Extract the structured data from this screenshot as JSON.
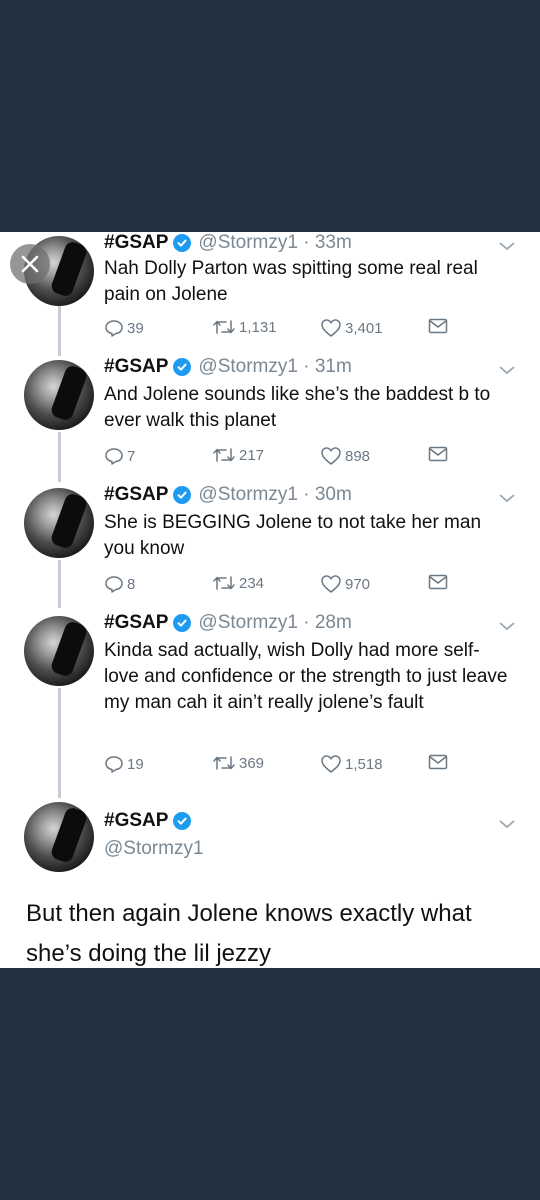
{
  "colors": {
    "background": "#22303f",
    "card": "#ffffff",
    "verified": "#1d9bf0",
    "muted": "#7a8894"
  },
  "viewer": {
    "close_icon": "close-icon"
  },
  "tweets": [
    {
      "name": "#GSAP",
      "handle": "@Stormzy1 · 33m",
      "text": "Nah Dolly Parton was spitting some real real pain on Jolene",
      "replies": "39",
      "retweets": "1,131",
      "likes": "3,401"
    },
    {
      "name": "#GSAP",
      "handle": "@Stormzy1 · 31m",
      "text": "And Jolene sounds like she’s the baddest b to ever walk this planet",
      "replies": "7",
      "retweets": "217",
      "likes": "898"
    },
    {
      "name": "#GSAP",
      "handle": "@Stormzy1 · 30m",
      "text": "She is BEGGING Jolene to not take her man you know",
      "replies": "8",
      "retweets": "234",
      "likes": "970"
    },
    {
      "name": "#GSAP",
      "handle": "@Stormzy1 · 28m",
      "text": "Kinda sad actually, wish Dolly had more self-love and confidence or the strength to just leave my man cah it ain’t really jolene’s fault",
      "replies": "19",
      "retweets": "369",
      "likes": "1,518"
    }
  ],
  "last_tweet": {
    "name": "#GSAP",
    "handle": "@Stormzy1",
    "text": "But then again Jolene knows exactly what she’s doing the lil jezzy"
  }
}
